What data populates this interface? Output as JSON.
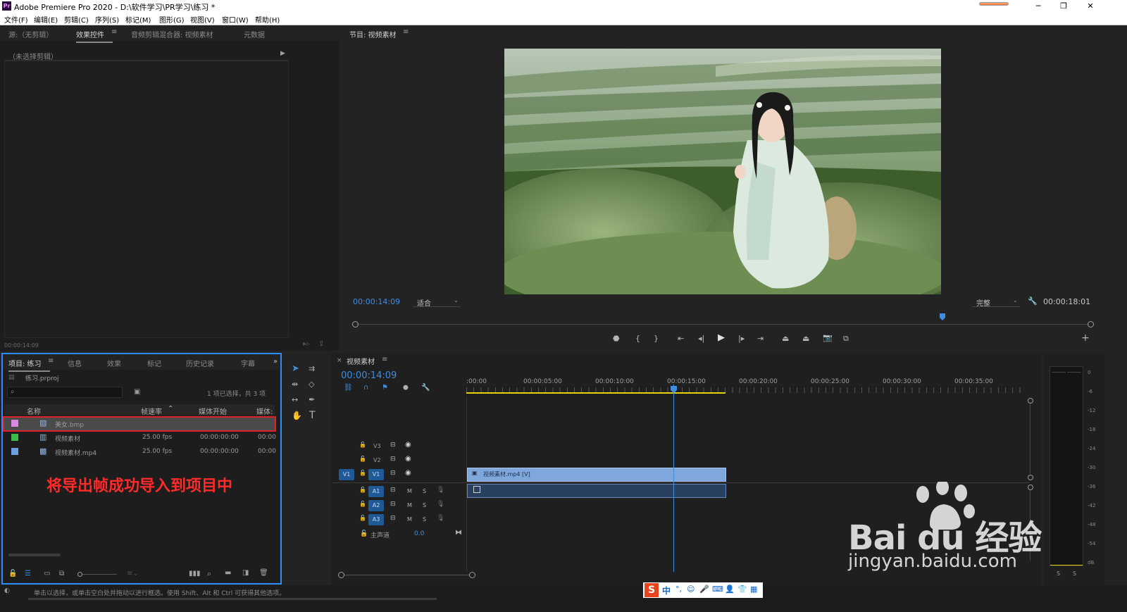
{
  "window": {
    "title": "Adobe Premiere Pro 2020 - D:\\软件学习\\PR学习\\练习 *",
    "app_icon": "Pr",
    "controls": {
      "minimize": "─",
      "maximize": "❐",
      "close": "✕"
    }
  },
  "menu": [
    "文件(F)",
    "编辑(E)",
    "剪辑(C)",
    "序列(S)",
    "标记(M)",
    "图形(G)",
    "视图(V)",
    "窗口(W)",
    "帮助(H)"
  ],
  "source_panel": {
    "tabs": [
      "源:（无剪辑）",
      "效果控件",
      "音频剪辑混合器: 视频素材",
      "元数据"
    ],
    "active_tab": "效果控件",
    "no_clip_text": "（未选择剪辑）",
    "timecode": "00:00:14:09"
  },
  "program_monitor": {
    "title": "节目: 视频素材",
    "timecode_current": "00:00:14:09",
    "fit_select": "适合",
    "quality_select": "完整",
    "timecode_duration": "00:00:18:01",
    "playhead_fraction": 0.8
  },
  "project_panel": {
    "tabs": [
      "项目: 练习",
      "信息",
      "效果",
      "标记",
      "历史记录",
      "字幕"
    ],
    "active_tab": "项目: 练习",
    "project_file": "练习.prproj",
    "selection_info": "1 项已选择，共 3 项",
    "columns": [
      "名称",
      "帧速率",
      "媒体开始",
      "媒体:"
    ],
    "items": [
      {
        "name": "美女.bmp",
        "fps": "",
        "start": "",
        "end": "",
        "color": "#d88ae0",
        "icon": "image-icon",
        "selected": true
      },
      {
        "name": "视频素材",
        "fps": "25.00 fps",
        "start": "00:00:00:00",
        "end": "00:00",
        "color": "#3dbb4a",
        "icon": "sequence-icon",
        "selected": false
      },
      {
        "name": "视频素材.mp4",
        "fps": "25.00 fps",
        "start": "00:00:00:00",
        "end": "00:00",
        "color": "#6fa1e0",
        "icon": "video-file-icon",
        "selected": false
      }
    ],
    "annotation": "将导出帧成功导入到项目中"
  },
  "timeline": {
    "tab": "视频素材",
    "timecode": "00:00:14:09",
    "ruler_labels": [
      ":00:00",
      "00:00:05:00",
      "00:00:10:00",
      "00:00:15:00",
      "00:00:20:00",
      "00:00:25:00",
      "00:00:30:00",
      "00:00:35:00"
    ],
    "video_tracks": [
      "V3",
      "V2",
      "V1"
    ],
    "audio_tracks": [
      "A1",
      "A2",
      "A3"
    ],
    "source_patch_v": "V1",
    "master_label": "主声道",
    "master_value": "0.0",
    "clip_label": "视频素材.mp4 [V]",
    "mute_label": "M",
    "solo_label": "S"
  },
  "audio_meter": {
    "scale": [
      "0",
      "-6",
      "-12",
      "-18",
      "-24",
      "-30",
      "-36",
      "-42",
      "-48",
      "-54",
      "dB"
    ],
    "solo": [
      "S",
      "S"
    ]
  },
  "status_bar": {
    "text": "单击以选择，或单击空白处并拖动以进行框选。使用 Shift、Alt 和 Ctrl 可获得其他选项。",
    "ime": "中"
  },
  "watermark": {
    "brand": "Bai du 经验",
    "url": "jingyan.baidu.com"
  },
  "colors": {
    "accent_blue": "#2d8cff",
    "timecode_blue": "#3f8ee0",
    "clip_blue": "#7fa7dc",
    "annotation_red": "#ff2a2a",
    "selection_red": "#e0202a",
    "work_area_yellow": "#e6d20a"
  }
}
